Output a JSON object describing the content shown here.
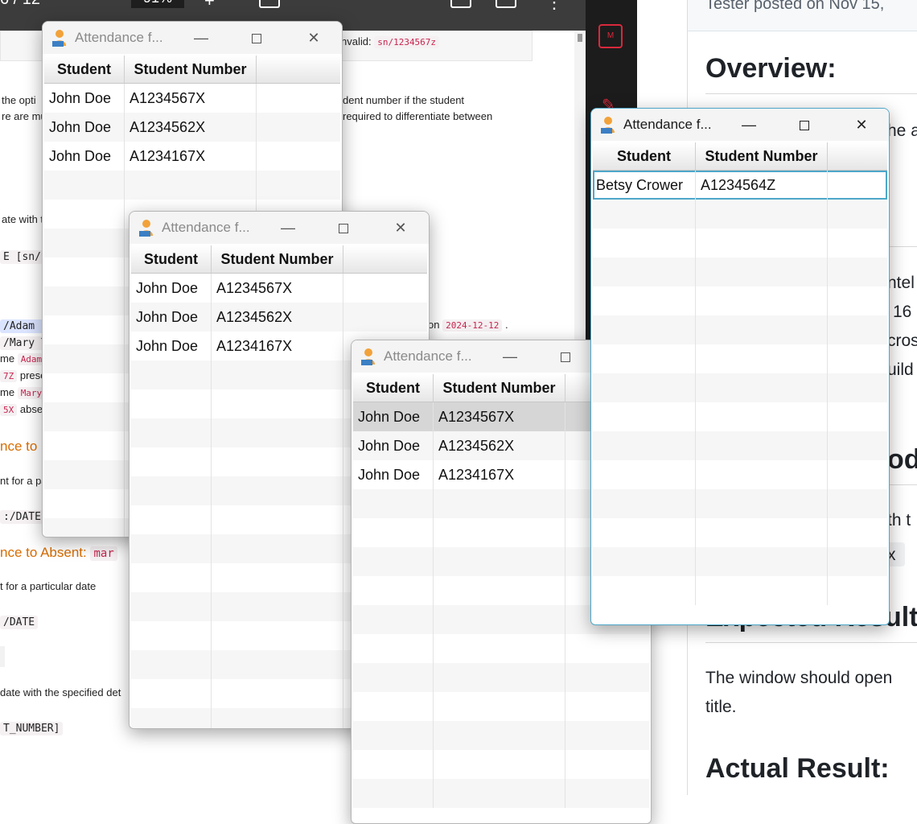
{
  "viewer": {
    "page_indicator": "6 / 12",
    "zoom": "91%",
    "plus": "+",
    "more": "⋮"
  },
  "doc_left": {
    "invalid_label": "nvalid:",
    "invalid_code": "sn/1234567z",
    "line1a": "the opti",
    "line1b": "dent number if the student",
    "line2a": "re are mu",
    "line2b": "required to differentiate between",
    "line3": "ate with t",
    "code_sn": "E [sn/STI",
    "code_adam": "/Adam Le",
    "code_mary": "/Mary Ta",
    "me1": "me",
    "code_adam2": "Adam",
    "code_7z": "7Z",
    "prese": "prese",
    "me2": "me",
    "code_mary2": "Mary",
    "code_5x": "5X",
    "absen": "absen",
    "on_label": "on",
    "code_date1": "2024-12-12",
    "heading1": "nce to",
    "t_for_a": "nt for a pa",
    "code_date_param": ":/DATE",
    "heading2_a": "nce to Absent:",
    "heading2_b": "mar",
    "particular": "t for a particular date",
    "code_date_param2": "/DATE",
    "spec_line": "date with the specified det",
    "code_number": "T_NUMBER]"
  },
  "doc_right": {
    "posted": "Tester posted on Nov 15,",
    "overview": "Overview:",
    "frag_ea": "he a",
    "frag_ntel": "ntel",
    "frag_16": "16",
    "frag_cros": "cros",
    "frag_uild": "uild",
    "frag_odu": "odu",
    "frag_th": "th t",
    "frag_x": "x",
    "expected": "Expected Result:",
    "window_should": "The window should open",
    "title_word": "title.",
    "actual": "Actual Result:"
  },
  "windows": [
    {
      "title": "Attendance f...",
      "columns": [
        "Student",
        "Student Number"
      ],
      "rows": [
        [
          "John Doe",
          "A1234567X"
        ],
        [
          "John Doe",
          "A1234562X"
        ],
        [
          "John Doe",
          "A1234167X"
        ]
      ]
    },
    {
      "title": "Attendance f...",
      "columns": [
        "Student",
        "Student Number"
      ],
      "rows": [
        [
          "John Doe",
          "A1234567X"
        ],
        [
          "John Doe",
          "A1234562X"
        ],
        [
          "John Doe",
          "A1234167X"
        ]
      ]
    },
    {
      "title": "Attendance f...",
      "columns": [
        "Student",
        "Student Number"
      ],
      "rows": [
        [
          "John Doe",
          "A1234567X"
        ],
        [
          "John Doe",
          "A1234562X"
        ],
        [
          "John Doe",
          "A1234167X"
        ]
      ]
    },
    {
      "title": "Attendance f...",
      "columns": [
        "Student",
        "Student Number"
      ],
      "rows": [
        [
          "Betsy Crower",
          "A1234564Z"
        ]
      ]
    }
  ],
  "window_controls": {
    "minimize": "—",
    "close": "✕"
  },
  "colors": {
    "accent": "#4ea7c9",
    "code_pink": "#c7254e",
    "heading_orange": "#d86c00"
  }
}
